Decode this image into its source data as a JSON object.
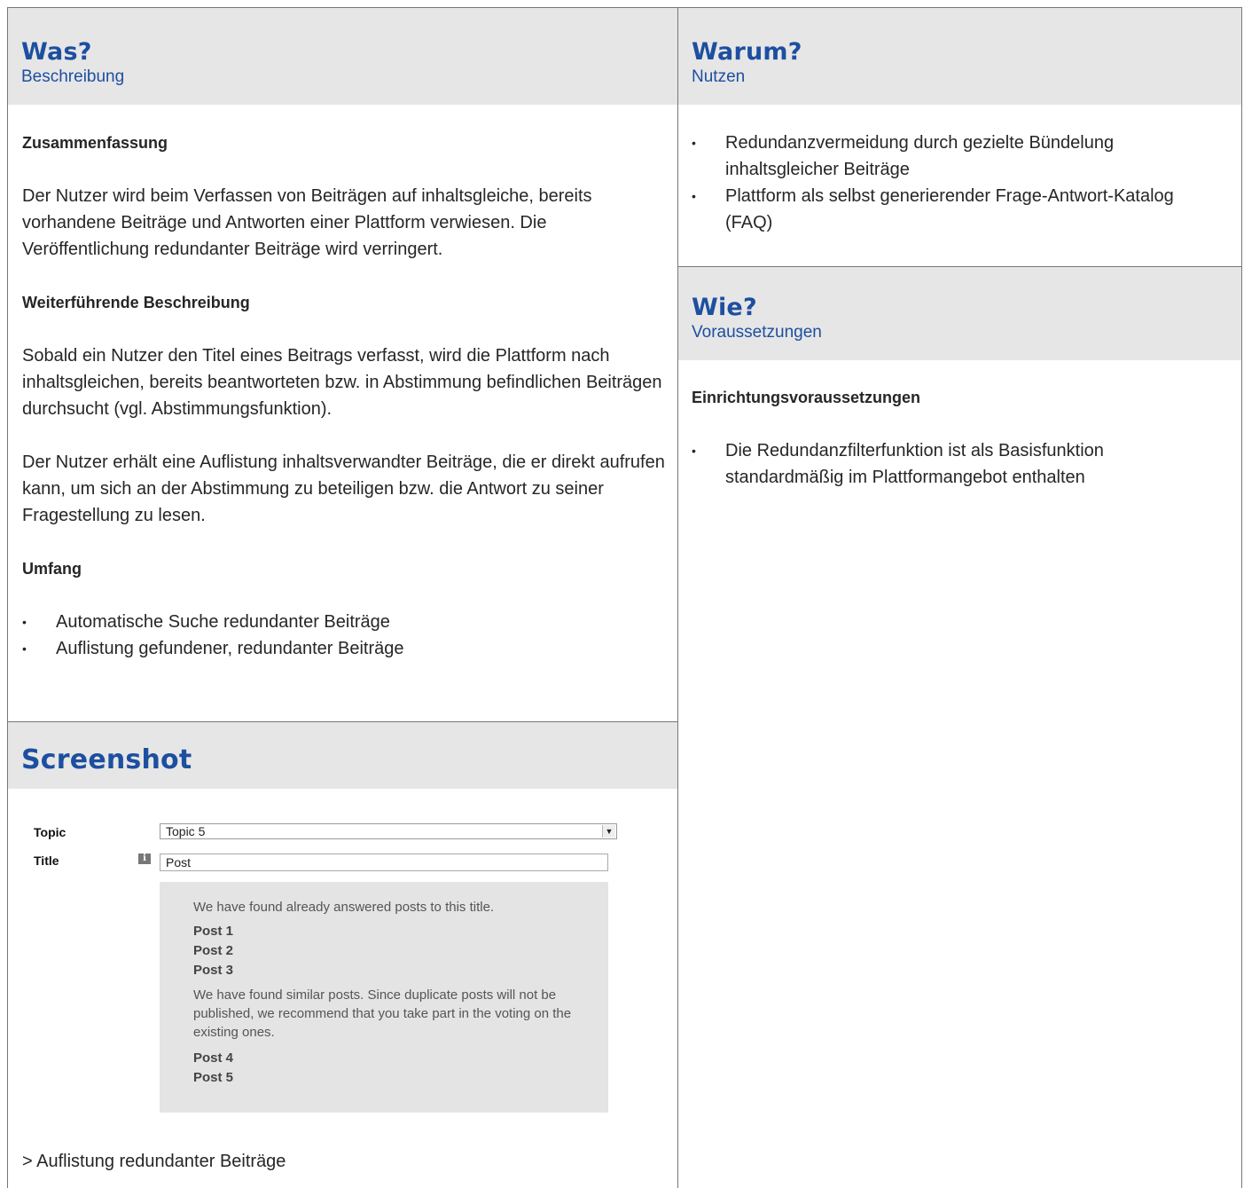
{
  "left": {
    "was": {
      "title": "Was?",
      "subtitle": "Beschreibung"
    },
    "summary_heading": "Zusammenfassung",
    "summary_text": "Der Nutzer wird beim Verfassen von Beiträgen auf inhaltsgleiche, bereits vorhandene Beiträge und Antworten einer Plattform verwiesen. Die Veröffentlichung redundanter Beiträge wird verringert.",
    "further_heading": "Weiterführende Beschreibung",
    "further_text_1": "Sobald ein Nutzer den Titel eines Beitrags verfasst, wird die Plattform nach inhaltsgleichen, bereits beantworteten bzw. in Abstimmung befindlichen Beiträgen durchsucht (vgl. Abstimmungsfunktion).",
    "further_text_2": "Der Nutzer erhält eine Auflistung inhaltsverwandter Beiträge, die er direkt aufrufen kann, um sich an der Abstimmung zu beteiligen bzw. die Antwort zu seiner Fragestellung zu lesen.",
    "scope_heading": "Umfang",
    "scope_items": [
      "Automatische Suche redundanter Beiträge",
      "Auflistung gefundener, redundanter Beiträge"
    ],
    "screenshot_title": "Screenshot",
    "caption": "> Auflistung redundanter Beiträge"
  },
  "right": {
    "warum": {
      "title": "Warum?",
      "subtitle": "Nutzen"
    },
    "benefits": [
      "Redundanzvermeidung durch gezielte Bündelung inhaltsgleicher Beiträge",
      "Plattform als selbst generierender Frage-Antwort-Katalog (FAQ)"
    ],
    "wie": {
      "title": "Wie?",
      "subtitle": "Voraussetzungen"
    },
    "req_heading": "Einrichtungsvoraussetzungen",
    "requirements": [
      "Die Redundanzfilterfunktion ist als Basisfunktion standardmäßig im Plattformangebot enthalten"
    ]
  },
  "shot": {
    "topic_label": "Topic",
    "topic_value": "Topic 5",
    "title_label": "Title",
    "info_icon": "i",
    "title_value": "Post",
    "answered_msg": "We have found already answered posts to this title.",
    "answered_posts": [
      "Post 1",
      "Post 2",
      "Post 3"
    ],
    "similar_msg": "We have found similar posts. Since duplicate posts will not be published, we recommend that you take part in the voting on the existing ones.",
    "similar_posts": [
      "Post 4",
      "Post 5"
    ]
  },
  "colors": {
    "accent": "#1d4fa0",
    "header_bg": "#e6e6e6",
    "panel_bg": "#e4e4e4"
  }
}
